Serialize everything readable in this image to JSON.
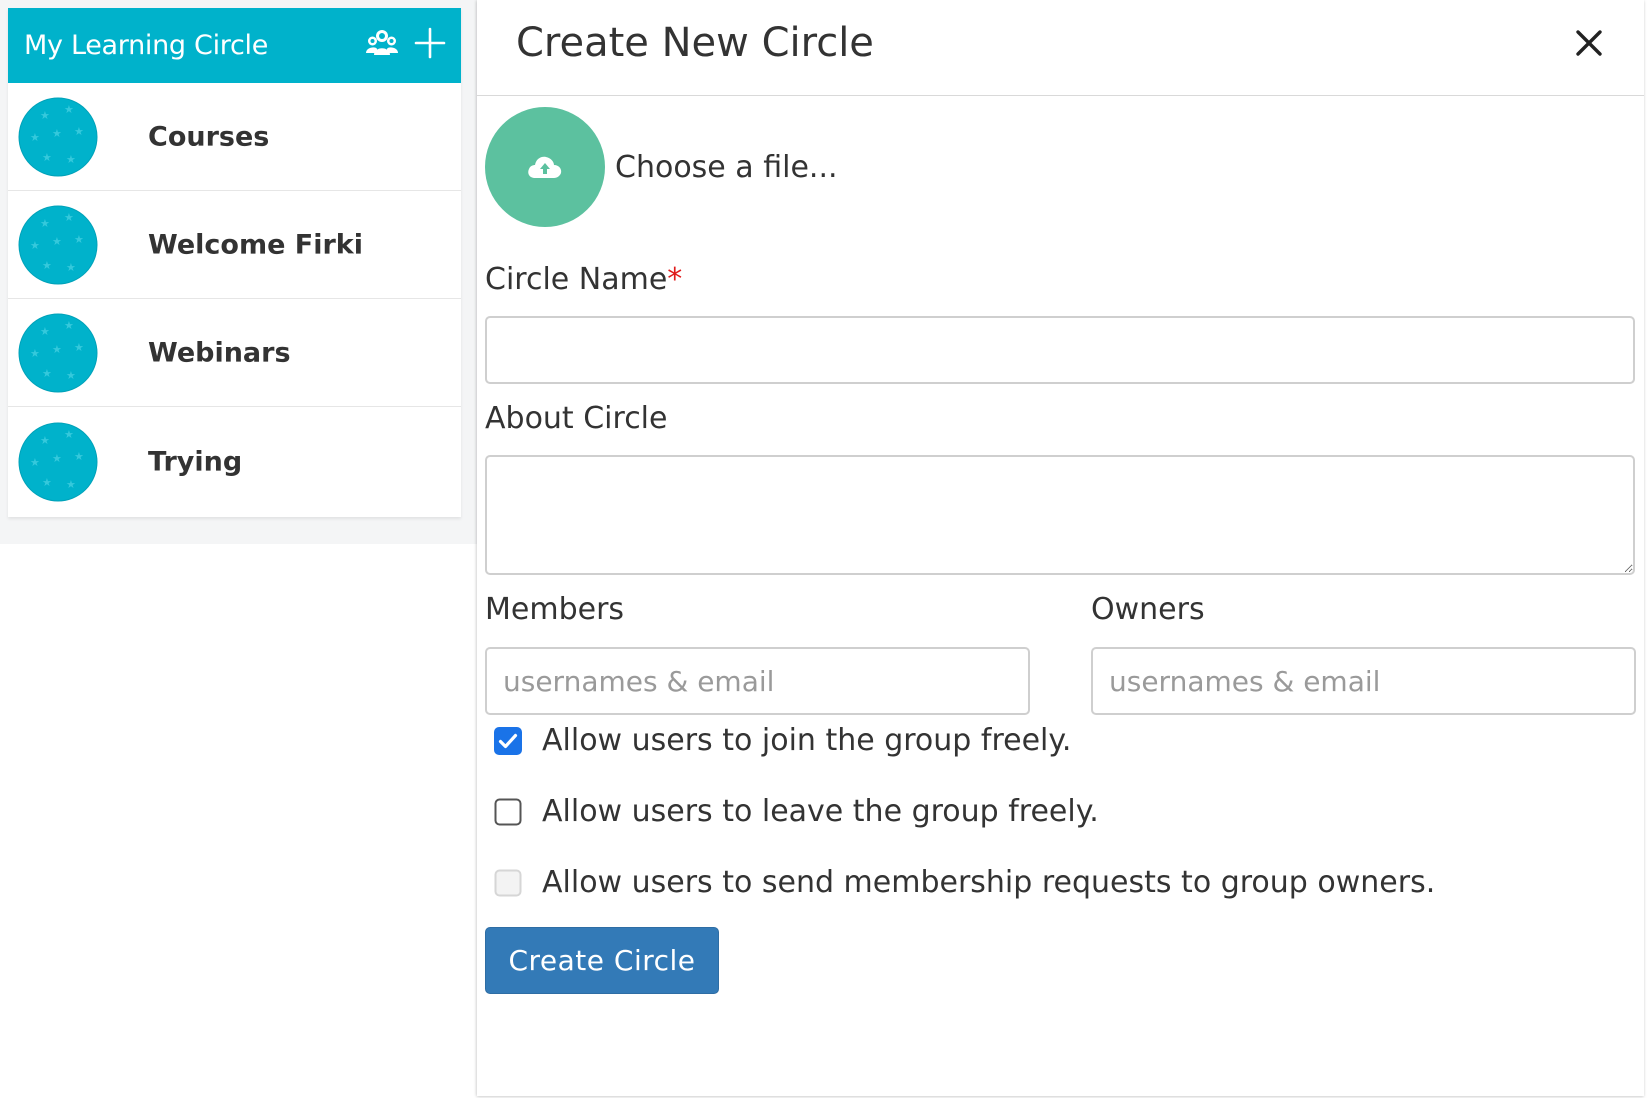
{
  "sidebar": {
    "title": "My Learning Circle",
    "items": [
      {
        "label": "Courses"
      },
      {
        "label": "Welcome Firki"
      },
      {
        "label": "Webinars"
      },
      {
        "label": "Trying"
      }
    ]
  },
  "modal": {
    "title": "Create New Circle",
    "upload_label": "Choose a file...",
    "circle_name_label": "Circle Name",
    "required_mark": "*",
    "about_label": "About Circle",
    "members_label": "Members",
    "members_placeholder": "usernames & email",
    "owners_label": "Owners",
    "owners_placeholder": "usernames & email",
    "options": [
      {
        "label": "Allow users to join the group freely.",
        "checked": true
      },
      {
        "label": "Allow users to leave the group freely.",
        "checked": false
      },
      {
        "label": "Allow users to send membership requests to group owners.",
        "checked": false,
        "disabled": true
      }
    ],
    "submit_label": "Create Circle"
  },
  "colors": {
    "header": "#00b2cb",
    "upload": "#5cc19f",
    "primary": "#337ab7",
    "checkbox_checked": "#1a73e8"
  }
}
